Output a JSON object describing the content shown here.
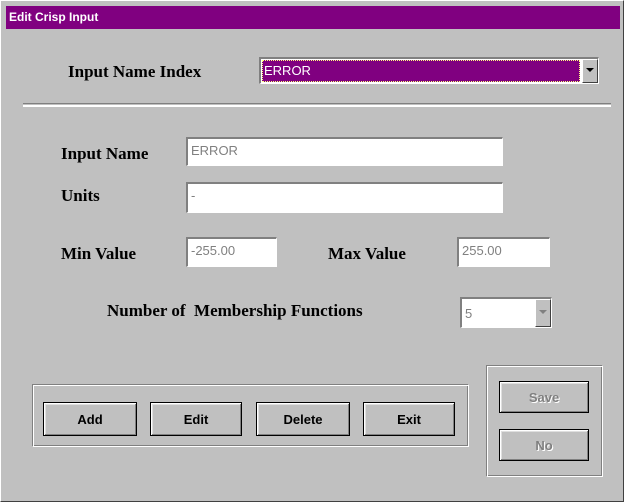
{
  "window": {
    "title": "Edit Crisp Input"
  },
  "header": {
    "input_name_index_label": "Input Name Index",
    "input_name_index_value": "ERROR"
  },
  "form": {
    "input_name_label": "Input Name",
    "input_name_value": "ERROR",
    "units_label": "Units",
    "units_value": "-",
    "min_value_label": "Min Value",
    "min_value": "-255.00",
    "max_value_label": "Max Value",
    "max_value": "255.00",
    "num_mf_label": "Number of  Membership Functions",
    "num_mf_value": "5"
  },
  "buttons": {
    "add": "Add",
    "edit": "Edit",
    "delete": "Delete",
    "exit": "Exit",
    "save": "Save",
    "no": "No"
  },
  "colors": {
    "title_bar": "#800080",
    "window_bg": "#c0c0c0",
    "selection": "#800080"
  }
}
